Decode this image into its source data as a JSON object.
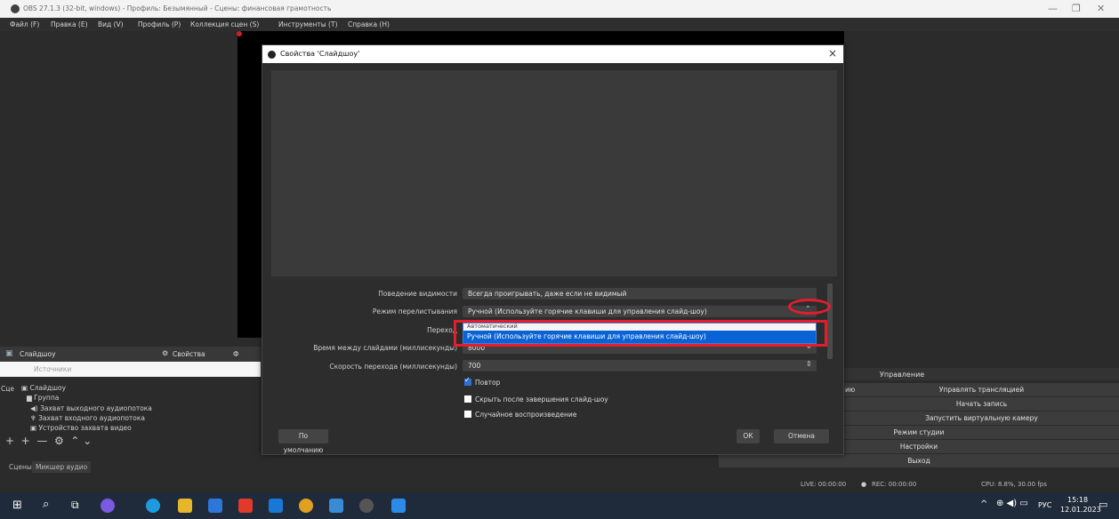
{
  "window": {
    "title": "OBS 27.1.3 (32-bit, windows) - Профиль: Безымянный - Сцены: финансовая грамотность",
    "controls": [
      "—",
      "❐",
      "✕"
    ]
  },
  "menu": [
    "Файл (F)",
    "Правка (E)",
    "Вид (V)",
    "Профиль (P)",
    "Коллекция сцен (S)",
    "Инструменты (T)",
    "Справка (H)"
  ],
  "sources_dock": {
    "header_item": "Слайдшоу",
    "properties_button": "Свойства",
    "filters_button": "Ф",
    "tab_label": "Источники",
    "scenes_label": "Сце",
    "items": [
      "Слайдшоу",
      "Группа",
      "Захват выходного аудиопотока",
      "Захват входного аудиопотока",
      "Устройство захвата видео"
    ],
    "bottom_tabs": [
      "Сцены",
      "Микшер аудио"
    ]
  },
  "controls_dock": {
    "title": "Управление",
    "buttons": [
      "Управлять трансляцией",
      "Начать запись",
      "Запустить виртуальную камеру",
      "Режим студии",
      "Настройки",
      "Выход"
    ],
    "left_fragment": "ию"
  },
  "status": {
    "live": "LIVE: 00:00:00",
    "rec": "REC: 00:00:00",
    "cpu": "CPU: 8.8%, 30.00 fps"
  },
  "dialog": {
    "title": "Свойства 'Слайдшоу'",
    "close": "×",
    "props": [
      {
        "label": "Поведение видимости",
        "value": "Всегда проигрывать, даже если не видимый"
      },
      {
        "label": "Режим перелистывания",
        "value": "Ручной (Используйте горячие клавиши для управления слайд-шоу)"
      },
      {
        "label": "Переход",
        "value": ""
      },
      {
        "label": "Время между слайдами (миллисекунды)",
        "value": "8000"
      },
      {
        "label": "Скорость перехода (миллисекунды)",
        "value": "700"
      }
    ],
    "dropdown": {
      "option_prev": "Автоматический",
      "option_selected": "Ручной (Используйте горячие клавиши для управления слайд-шоу)"
    },
    "checkboxes": [
      {
        "label": "Повтор",
        "checked": true
      },
      {
        "label": "Скрыть после завершения слайд-шоу",
        "checked": false
      },
      {
        "label": "Случайное воспроизведение",
        "checked": false
      }
    ],
    "defaults_button": "По умолчанию",
    "ok_button": "ОК",
    "cancel_button": "Отмена"
  },
  "taskbar": {
    "tray": "^",
    "lang": "РУС",
    "time": "15:18",
    "date": "12.01.2023"
  }
}
